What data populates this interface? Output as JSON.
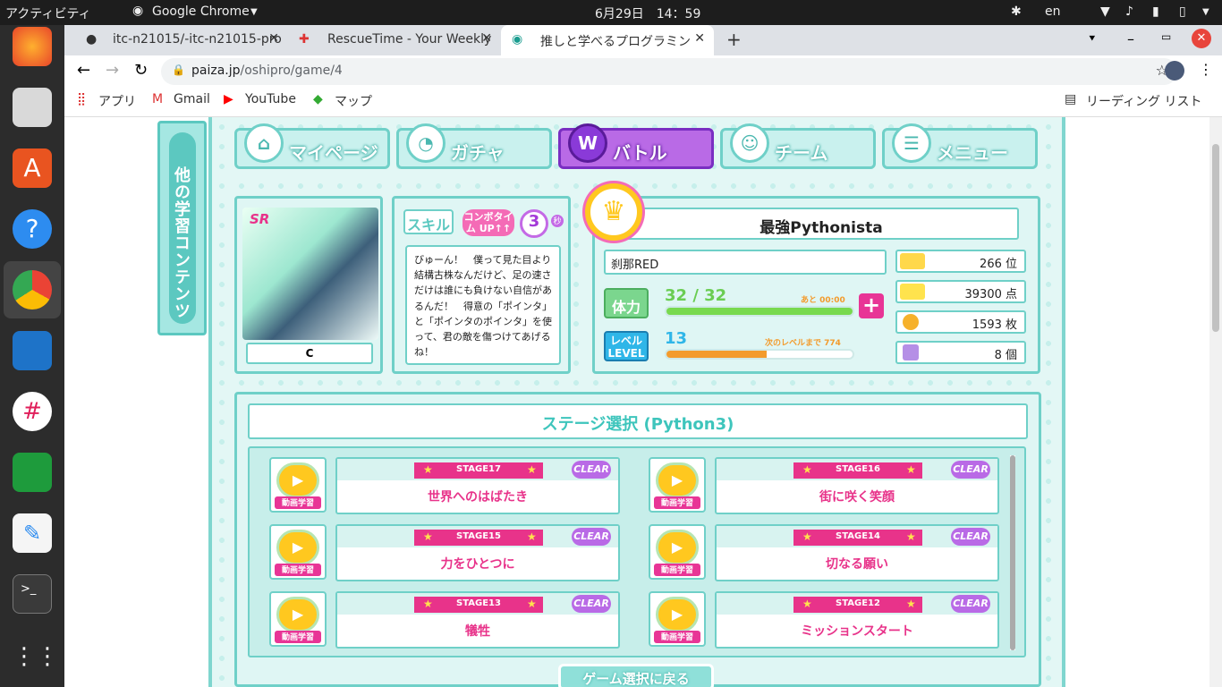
{
  "os": {
    "activities": "アクティビティ",
    "app": "Google Chrome",
    "clock": "6月29日　14：59",
    "lang": "en"
  },
  "tabs": [
    {
      "label": "itc-n21015/-itc-n21015-pro"
    },
    {
      "label": "RescueTime - Your Weekly"
    },
    {
      "label": "推しと学べるプログラミン"
    }
  ],
  "url": {
    "host": "paiza.jp",
    "path": "/oshipro/game/4"
  },
  "bookmarks": {
    "apps": "アプリ",
    "gmail": "Gmail",
    "youtube": "YouTube",
    "maps": "マップ",
    "reading": "リーディング リスト"
  },
  "side": {
    "label": "他の学習コンテンツ"
  },
  "nav": [
    {
      "label": "マイページ",
      "icon": "home-icon"
    },
    {
      "label": "ガチャ",
      "icon": "gacha-icon"
    },
    {
      "label": "バトル",
      "icon": "battle-icon",
      "active": true
    },
    {
      "label": "チーム",
      "icon": "team-icon"
    },
    {
      "label": "メニュー",
      "icon": "menu-icon"
    }
  ],
  "card": {
    "rarity": "SR",
    "name": "C"
  },
  "skill": {
    "label": "スキル",
    "combo": "コンボタイム UP↑↑",
    "count": "3",
    "unit": "秒",
    "desc": "びゅーん！　僕って見た目より結構古株なんだけど、足の速さだけは誰にも負けない自信があるんだ！　得意の「ポインタ」と「ポインタのポインタ」を使って、君の敵を傷つけてあげるね！"
  },
  "player": {
    "name": "最強Pythonista",
    "title": "刹那RED",
    "hp_label": "体力",
    "hp": "32 / 32",
    "hp_note": "あと 00:00",
    "hp_ratio": 1.0,
    "level_label": "レベル LEVEL",
    "level": "13",
    "level_note": "次のレベルまで 774",
    "level_ratio": 0.54,
    "rank": "266 位",
    "score": "39300 点",
    "coins": "1593 枚",
    "items": "8 個"
  },
  "stage": {
    "title": "ステージ選択 (Python3)",
    "video_label": "動画学習",
    "clear": "CLEAR",
    "items": [
      {
        "no": "STAGE17",
        "name": "世界へのはばたき"
      },
      {
        "no": "STAGE16",
        "name": "街に咲く笑顔"
      },
      {
        "no": "STAGE15",
        "name": "力をひとつに"
      },
      {
        "no": "STAGE14",
        "name": "切なる願い"
      },
      {
        "no": "STAGE13",
        "name": "犠牲"
      },
      {
        "no": "STAGE12",
        "name": "ミッションスタート"
      }
    ],
    "back": "ゲーム選択に戻る"
  },
  "colors": {
    "teal": "#6fd0c8",
    "pink": "#e8338a",
    "purple": "#b96ae6"
  }
}
